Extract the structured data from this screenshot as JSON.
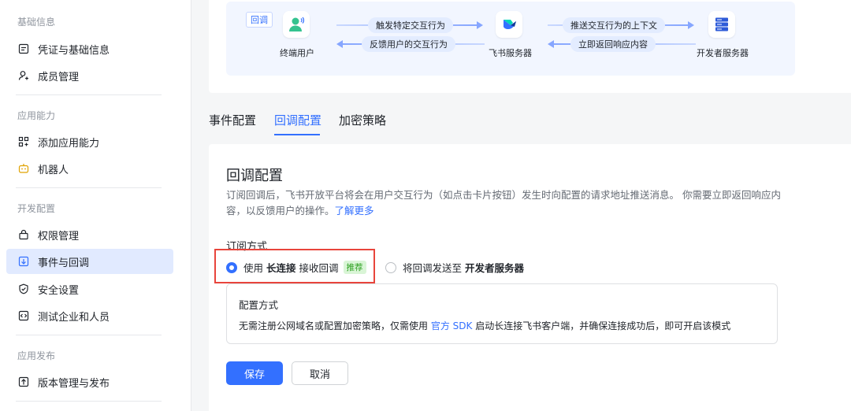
{
  "sidebar": {
    "sections": [
      {
        "title": "基础信息",
        "items": [
          "凭证与基础信息",
          "成员管理"
        ]
      },
      {
        "title": "应用能力",
        "items": [
          "添加应用能力",
          "机器人"
        ]
      },
      {
        "title": "开发配置",
        "items": [
          "权限管理",
          "事件与回调",
          "安全设置",
          "测试企业和人员"
        ]
      },
      {
        "title": "应用发布",
        "items": [
          "版本管理与发布"
        ]
      }
    ]
  },
  "flow": {
    "tag": "回调",
    "nodes": [
      "终端用户",
      "飞书服务器",
      "开发者服务器"
    ],
    "arrows": [
      "触发特定交互行为",
      "反馈用户的交互行为",
      "推送交互行为的上下文",
      "立即返回响应内容"
    ]
  },
  "tabs": [
    "事件配置",
    "回调配置",
    "加密策略"
  ],
  "main": {
    "title": "回调配置",
    "desc_line1": "订阅回调后，飞书开放平台将会在用户交互行为（如点击卡片按钮）发生时向配置的请求地址推送消息。 你需要立即返回响应内",
    "desc_line2": "容，以反馈用户的操作。",
    "learn_more": "了解更多",
    "subscribe_label": "订阅方式",
    "option1": {
      "pre": "使用",
      "bold": "长连接",
      "post": "接收回调",
      "badge": "推荐"
    },
    "option2": {
      "pre": "将回调发送至",
      "bold": "开发者服务器"
    },
    "config_title": "配置方式",
    "config_text_pre": "无需注册公网域名或配置加密策略，仅需使用",
    "config_link": "官方 SDK",
    "config_text_post": "启动长连接飞书客户端，并确保连接成功后，即可开启该模式",
    "save": "保存",
    "cancel": "取消"
  },
  "colors": {
    "accent": "#3370ff",
    "highlight": "#e8453c",
    "badge": "#2ea121"
  }
}
